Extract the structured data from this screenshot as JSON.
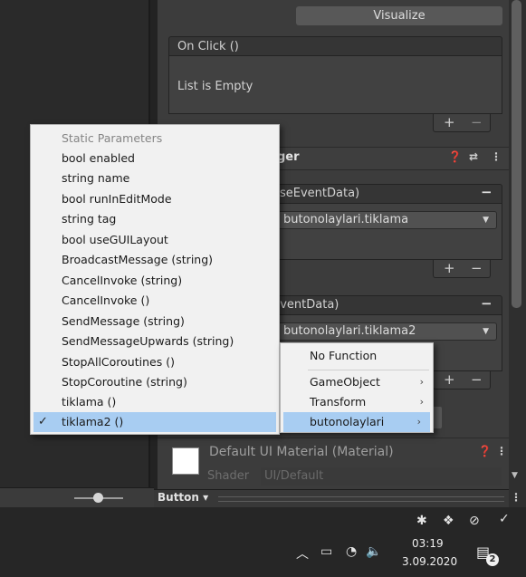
{
  "inspector": {
    "visualize_label": "Visualize",
    "on_click": {
      "header": "On Click ()",
      "empty_text": "List is Empty",
      "plus": "+",
      "minus": "−"
    },
    "event_trigger": {
      "title_fragment": "ger",
      "entry1": {
        "header_fragment": "seEventData)",
        "function": "butonolaylari.tiklama"
      },
      "entry2": {
        "header_fragment": "EventData)",
        "function": "butonolaylari.tiklama2"
      },
      "plus": "+",
      "minus": "−"
    },
    "material": {
      "title": "Default UI Material (Material)",
      "shader_label": "Shader",
      "shader_value": "UI/Default"
    },
    "bottom_toolbar": {
      "component_button": "Button ▾"
    }
  },
  "popup_menu": {
    "header": "Static Parameters",
    "items": [
      "bool enabled",
      "string name",
      "bool runInEditMode",
      "string tag",
      "bool useGUILayout",
      "BroadcastMessage (string)",
      "CancelInvoke (string)",
      "CancelInvoke ()",
      "SendMessage (string)",
      "SendMessageUpwards (string)",
      "StopAllCoroutines ()",
      "StopCoroutine (string)",
      "tiklama ()"
    ],
    "selected_item": "tiklama2 ()",
    "check_glyph": "✓"
  },
  "submenu": {
    "items": [
      "No Function",
      "GameObject",
      "Transform",
      "butonolaylari"
    ],
    "selected": "butonolaylari",
    "arrow_glyph": "›"
  },
  "taskbar": {
    "time": "03:19",
    "date": "3.09.2020",
    "notification_count": "2"
  },
  "colors": {
    "menu_selection": "#a8cdf2",
    "inspector_bg": "#3c3c3c",
    "menu_bg": "#f1f1f1"
  }
}
